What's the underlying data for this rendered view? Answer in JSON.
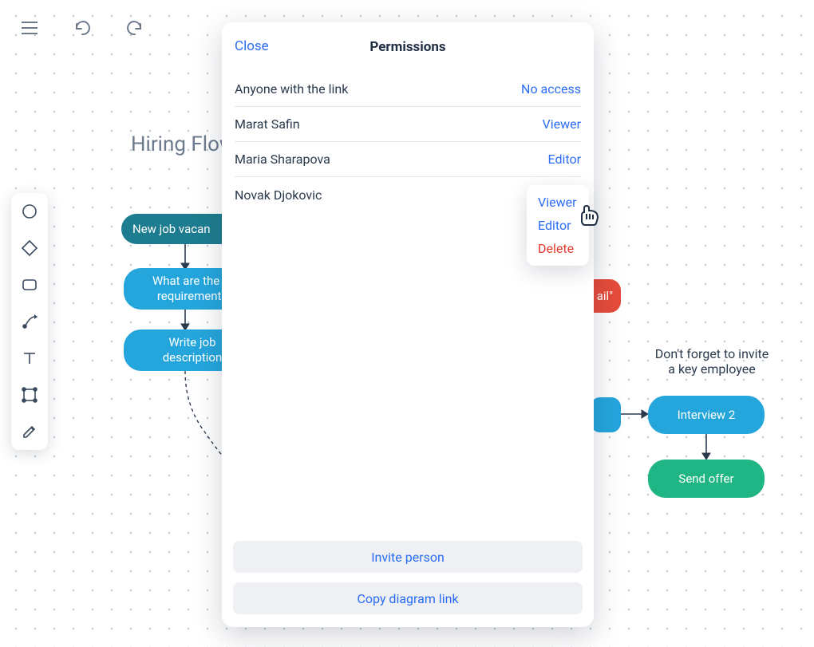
{
  "diagram": {
    "title": "Hiring Flow",
    "nodes": {
      "new_vacancy": "New job vacan",
      "requirements_line1": "What are the jo",
      "requirements_line2": "requirements",
      "write_jd_line1": "Write job",
      "write_jd_line2": "description",
      "interview2": "Interview 2",
      "send_offer": "Send offer",
      "red_fragment": "ail\""
    },
    "note_line1": "Don't forget to invite",
    "note_line2": "a key employee"
  },
  "modal": {
    "close": "Close",
    "title": "Permissions",
    "rows": [
      {
        "label": "Anyone with the link",
        "value": "No access"
      },
      {
        "label": "Marat Safin",
        "value": "Viewer"
      },
      {
        "label": "Maria Sharapova",
        "value": "Editor"
      },
      {
        "label": "Novak Djokovic",
        "value": ""
      }
    ],
    "invite": "Invite person",
    "copy": "Copy diagram link"
  },
  "popover": {
    "viewer": "Viewer",
    "editor": "Editor",
    "delete": "Delete"
  }
}
